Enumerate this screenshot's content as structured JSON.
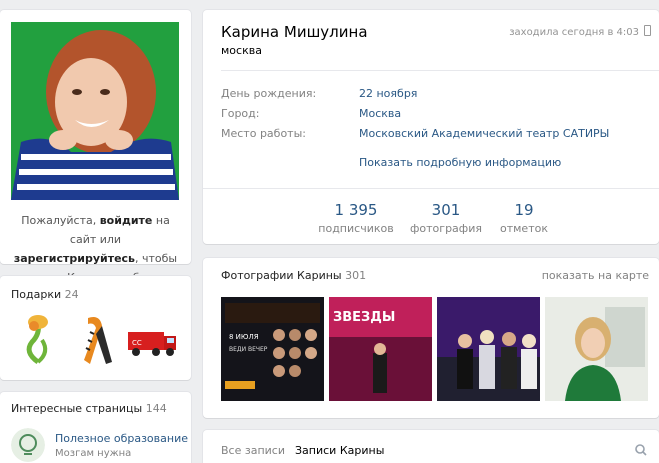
{
  "login_prompt": {
    "part1": "Пожалуйста, ",
    "login": "войдите",
    "part2": " на сайт или ",
    "register": "зарегистрируйтесь",
    "part3": ", чтобы написать Карине сообщение."
  },
  "gifts": {
    "title": "Подарки",
    "count": "24"
  },
  "interesting": {
    "title": "Интересные страницы",
    "count": "144",
    "item_title": "Полезное образование",
    "item_sub": "Мозгам нужна"
  },
  "profile": {
    "name": "Карина Мишулина",
    "status": "москва",
    "online": "заходила сегодня в 4:03",
    "rows": [
      {
        "label": "День рождения:",
        "value": "22 ноября"
      },
      {
        "label": "Город:",
        "value": "Москва"
      },
      {
        "label": "Место работы:",
        "value": "Московский Академический театр САТИРЫ"
      }
    ],
    "more_info": "Показать подробную информацию",
    "counters": [
      {
        "num": "1 395",
        "label": "подписчиков"
      },
      {
        "num": "301",
        "label": "фотография"
      },
      {
        "num": "19",
        "label": "отметок"
      }
    ]
  },
  "photos": {
    "title": "Фотографии Карины",
    "count": "301",
    "map_link": "показать на карте",
    "poster_date": "8 ИЮЛЯ",
    "poster_line": "ВЕДИ ВЕЧЕР",
    "show_banner": "ЗВЕЗДЫ"
  },
  "wall": {
    "tab_all": "Все записи",
    "tab_own": "Записи Карины"
  },
  "colors": {
    "link": "#2a5885",
    "bg": "#edeef0",
    "muted": "#828282"
  }
}
